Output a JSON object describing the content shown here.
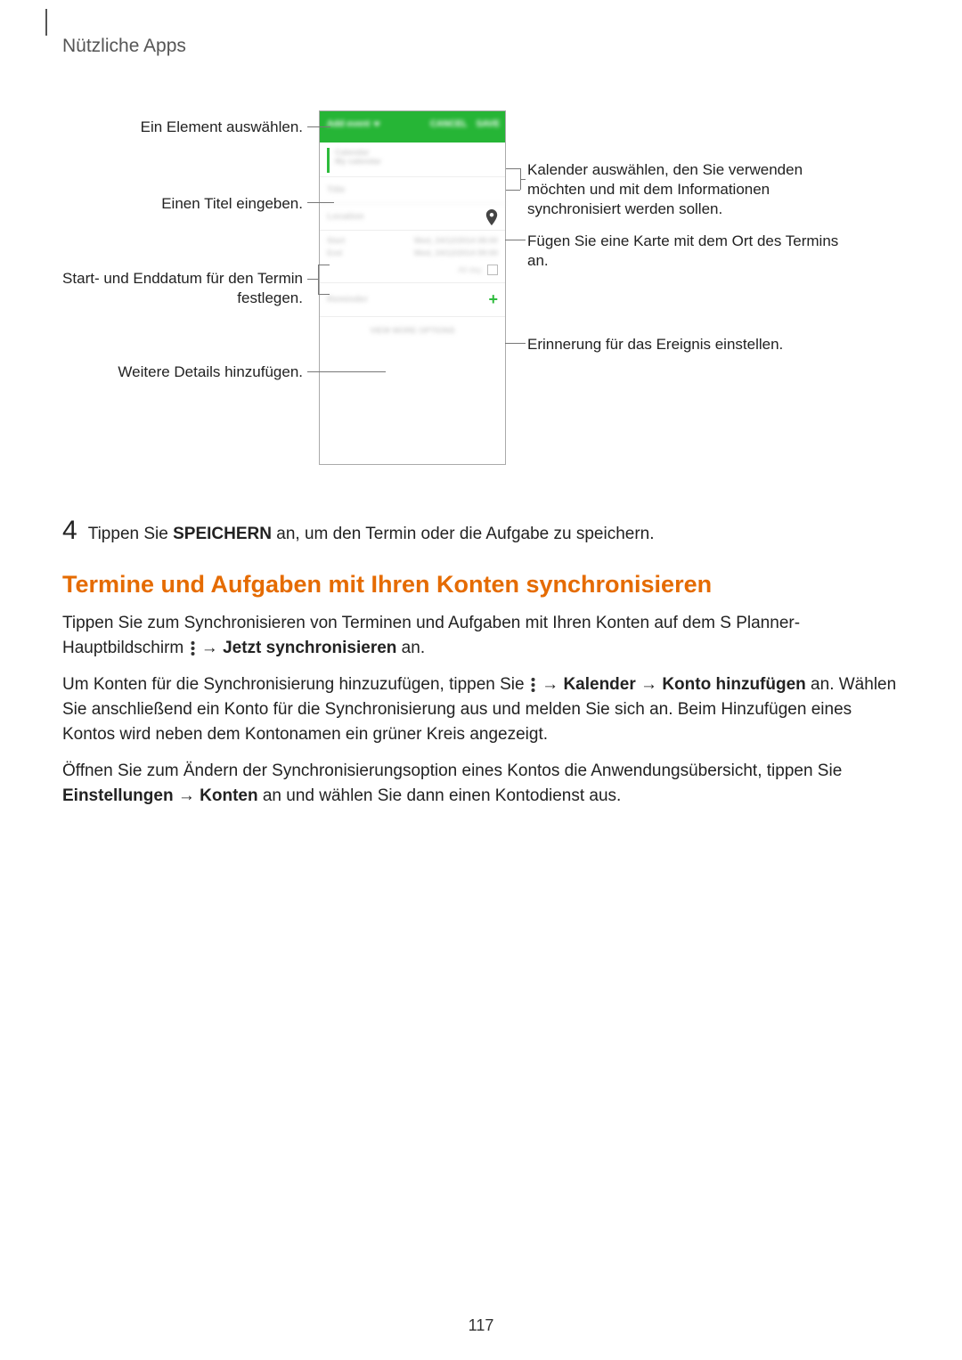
{
  "header": "Nützliche Apps",
  "callouts": {
    "select_element": "Ein Element auswählen.",
    "enter_title": "Einen Titel eingeben.",
    "start_end_date": "Start- und Enddatum für den Termin festlegen.",
    "add_details": "Weitere Details hinzufügen.",
    "select_calendar": "Kalender auswählen, den Sie verwenden möchten und mit dem Informationen synchronisiert werden sollen.",
    "add_map": "Fügen Sie eine Karte mit dem Ort des Termins an.",
    "set_reminder": "Erinnerung für das Ereignis einstellen."
  },
  "phone": {
    "dropdown": "Add event",
    "cancel": "CANCEL",
    "save": "SAVE",
    "calendar_label": "Calendar",
    "calendar_sub": "My calendar",
    "title_placeholder": "Title",
    "location_placeholder": "Location",
    "start_label": "Start",
    "end_label": "End",
    "start_value": "Wed, 24/12/2014  08:00",
    "end_value": "Wed, 24/12/2014  09:00",
    "allday_label": "All day",
    "reminder_label": "Reminder",
    "more_options": "VIEW MORE OPTIONS"
  },
  "step4": {
    "num": "4",
    "prefix": "Tippen Sie ",
    "bold": "SPEICHERN",
    "suffix": " an, um den Termin oder die Aufgabe zu speichern."
  },
  "heading": "Termine und Aufgaben mit Ihren Konten synchronisieren",
  "para1": {
    "a": "Tippen Sie zum Synchronisieren von Terminen und Aufgaben mit Ihren Konten auf dem S Planner-Hauptbildschirm ",
    "b": " → ",
    "c": "Jetzt synchronisieren",
    "d": " an."
  },
  "para2": {
    "a": "Um Konten für die Synchronisierung hinzuzufügen, tippen Sie ",
    "arrow1": " → ",
    "b1": "Kalender",
    "arrow2": " → ",
    "b2": "Konto hinzufügen",
    "c": " an. Wählen Sie anschließend ein Konto für die Synchronisierung aus und melden Sie sich an. Beim Hinzufügen eines Kontos wird neben dem Kontonamen ein grüner Kreis angezeigt."
  },
  "para3": {
    "a": "Öffnen Sie zum Ändern der Synchronisierungsoption eines Kontos die Anwendungsübersicht, tippen Sie ",
    "b1": "Einstellungen",
    "arrow": " → ",
    "b2": "Konten",
    "c": " an und wählen Sie dann einen Kontodienst aus."
  },
  "page_number": "117"
}
